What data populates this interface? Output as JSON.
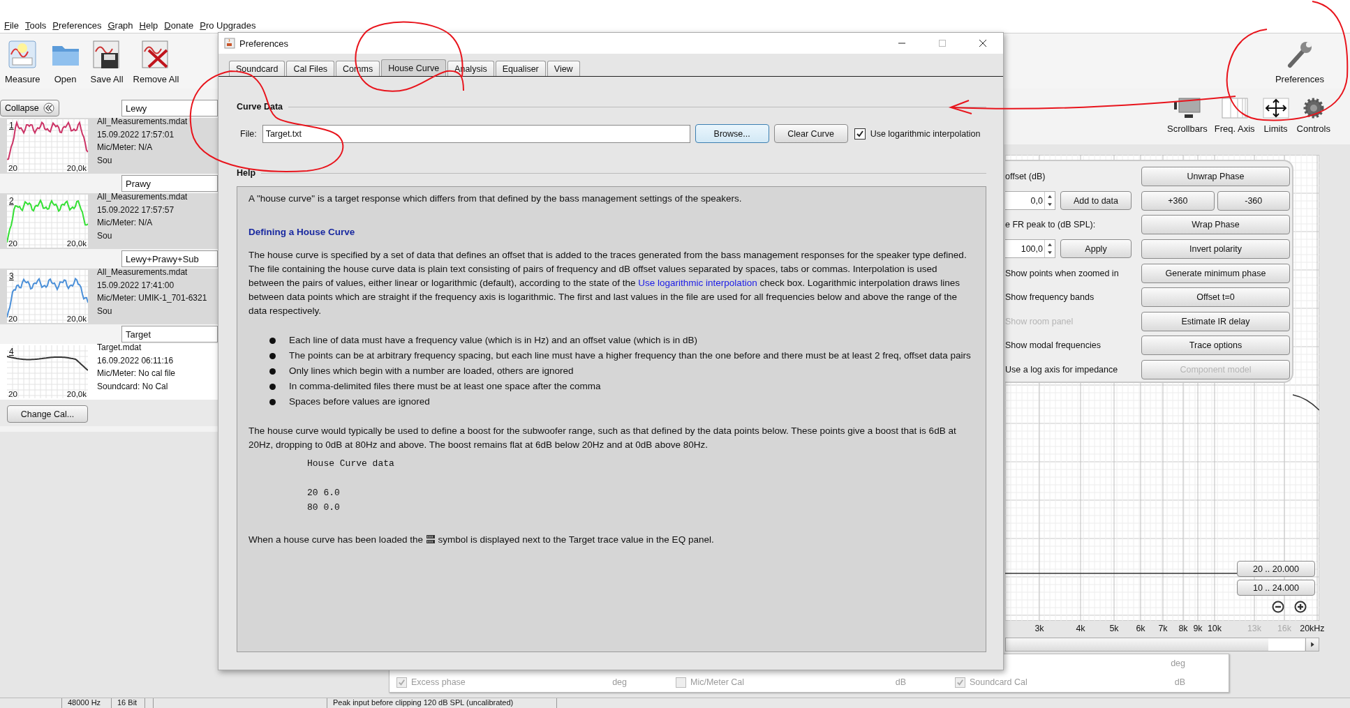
{
  "menu": [
    "File",
    "Tools",
    "Preferences",
    "Graph",
    "Help",
    "Donate",
    "Pro Upgrades"
  ],
  "toolbar": [
    {
      "label": "Measure",
      "kind": "measure"
    },
    {
      "label": "Open",
      "kind": "open"
    },
    {
      "label": "Save All",
      "kind": "save"
    },
    {
      "label": "Remove All",
      "kind": "remove"
    }
  ],
  "preferences_button": "Preferences",
  "collapse_button": "Collapse",
  "measurements": [
    {
      "name": "Lewy",
      "number": "1",
      "color": "#cc3366",
      "x_start": "20",
      "x_end": "20,0k",
      "file": "All_Measurements.mdat",
      "date": "15.09.2022 17:57:01",
      "mic": "Mic/Meter: N/A",
      "soundcard": "Sou",
      "selected": false
    },
    {
      "name": "Prawy",
      "number": "2",
      "color": "#33e033",
      "x_start": "20",
      "x_end": "20,0k",
      "file": "All_Measurements.mdat",
      "date": "15.09.2022 17:57:57",
      "mic": "Mic/Meter: N/A",
      "soundcard": "Sou",
      "selected": false
    },
    {
      "name": "Lewy+Prawy+Sub",
      "number": "3",
      "color": "#4a8fd8",
      "x_start": "20",
      "x_end": "20,0k",
      "file": "All_Measurements.mdat",
      "date": "15.09.2022 17:41:00",
      "mic": "Mic/Meter: UMIK-1_701-6321",
      "soundcard": "Sou",
      "selected": false
    },
    {
      "name": "Target",
      "number": "4",
      "color": "#333333",
      "x_start": "20",
      "x_end": "20,0k",
      "file": "Target.mdat",
      "date": "16.09.2022 06:11:16",
      "mic": "Mic/Meter: No cal file",
      "soundcard": "Soundcard: No Cal",
      "selected": true
    }
  ],
  "change_cal_button": "Change Cal...",
  "graph_toolbar": [
    {
      "label": "Scrollbars",
      "kind": "scrollbars"
    },
    {
      "label": "Freq. Axis",
      "kind": "freq"
    },
    {
      "label": "Limits",
      "kind": "limits"
    },
    {
      "label": "Controls",
      "kind": "controls"
    }
  ],
  "controls_panel": {
    "left_items": [
      {
        "kind": "label",
        "text": "offset (dB)"
      },
      {
        "kind": "spinner",
        "value": "0,0",
        "button": "Add to data"
      },
      {
        "kind": "label",
        "text": "e FR peak to (dB SPL):"
      },
      {
        "kind": "spinner",
        "value": "100,0",
        "button": "Apply"
      },
      {
        "kind": "option",
        "text": "Show points when zoomed in",
        "disabled": false
      },
      {
        "kind": "option",
        "text": "Show frequency bands",
        "disabled": false
      },
      {
        "kind": "option",
        "text": "Show room panel",
        "disabled": true
      },
      {
        "kind": "option",
        "text": "Show modal frequencies",
        "disabled": false
      },
      {
        "kind": "option",
        "text": "Use a log axis for impedance",
        "disabled": false
      }
    ],
    "button_rows": [
      [
        {
          "label": "Unwrap Phase",
          "disabled": false
        }
      ],
      [
        {
          "label": "+360",
          "disabled": false
        },
        {
          "label": "-360",
          "disabled": false
        }
      ],
      [
        {
          "label": "Wrap Phase",
          "disabled": false
        }
      ],
      [
        {
          "label": "Invert polarity",
          "disabled": false
        }
      ],
      [
        {
          "label": "Generate minimum phase",
          "disabled": false
        }
      ],
      [
        {
          "label": "Offset t=0",
          "disabled": false
        }
      ],
      [
        {
          "label": "Estimate IR delay",
          "disabled": false
        }
      ],
      [
        {
          "label": "Trace options",
          "disabled": false
        }
      ],
      [
        {
          "label": "Component model",
          "disabled": true
        }
      ]
    ]
  },
  "graph": {
    "range_buttons": [
      "20 .. 20.000",
      "10 .. 24.000"
    ],
    "freq_labels": [
      {
        "label": "3k",
        "minor": false
      },
      {
        "label": "4k",
        "minor": false
      },
      {
        "label": "5k",
        "minor": false
      },
      {
        "label": "6k",
        "minor": false
      },
      {
        "label": "7k",
        "minor": false
      },
      {
        "label": "8k",
        "minor": false
      },
      {
        "label": "9k",
        "minor": false
      },
      {
        "label": "10k",
        "minor": false
      },
      {
        "label": "13k",
        "minor": true
      },
      {
        "label": "16k",
        "minor": true
      },
      {
        "label": "20kHz",
        "minor": false
      }
    ]
  },
  "bottom_panel": {
    "top_unit": "deg",
    "rows": [
      {
        "label": "Excess phase",
        "unit": "deg",
        "checked": true
      },
      {
        "label": "Mic/Meter Cal",
        "unit": "dB",
        "checked": false
      },
      {
        "label": "Soundcard Cal",
        "unit": "dB",
        "checked": true
      }
    ]
  },
  "status_bar": {
    "sample_rate": "48000 Hz",
    "bit_depth": "16 Bit",
    "message": "Peak input before clipping 120 dB SPL (uncalibrated)"
  },
  "dialog": {
    "title": "Preferences",
    "tabs": [
      {
        "label": "Soundcard",
        "selected": false
      },
      {
        "label": "Cal Files",
        "selected": false
      },
      {
        "label": "Comms",
        "selected": false
      },
      {
        "label": "House Curve",
        "selected": true
      },
      {
        "label": "Analysis",
        "selected": false
      },
      {
        "label": "Equaliser",
        "selected": false
      },
      {
        "label": "View",
        "selected": false
      }
    ],
    "curve_data_heading": "Curve Data",
    "file_label": "File:",
    "file_value": "Target.txt",
    "browse_button": "Browse...",
    "clear_button": "Clear Curve",
    "log_interpolation": {
      "label": "Use logarithmic interpolation",
      "checked": true
    },
    "help_heading": "Help",
    "help": {
      "intro": "A \"house curve\" is a target response which differs from that defined by the bass management settings of the speakers.",
      "section_heading": "Defining a House Curve",
      "paragraph": {
        "before": "The house curve is specified by a set of data that defines an offset that is added to the traces generated from the bass management responses for the speaker type defined. The file containing the house curve data is plain text consisting of pairs of frequency and dB offset values separated by spaces, tabs or commas. Interpolation is used between the pairs of values, either linear or logarithmic (default), according to the state of the ",
        "link": "Use logarithmic interpolation",
        "after": " check box. Logarithmic interpolation draws lines between data points which are straight if the frequency axis is logarithmic. The first and last values in the file are used for all frequencies below and above the range of the data respectively."
      },
      "bullets": [
        "Each line of data must have a frequency value (which is in Hz) and an offset value (which is in dB)",
        "The points can be at arbitrary frequency spacing, but each line must have a higher frequency than the one before and there must be at least 2 freq, offset data pairs",
        "Only lines which begin with a number are loaded, others are ignored",
        "In comma-delimited files there must be at least one space after the comma",
        "Spaces before values are ignored"
      ],
      "example_paragraph": "The house curve would typically be used to define a boost for the subwoofer range, such as that defined by the data points below. These points give a boost that is 6dB at 20Hz, dropping to 0dB at 80Hz and above. The boost remains flat at 6dB below 20Hz and at 0dB above 80Hz.",
      "code_title": "House Curve data",
      "code_rows": [
        "20 6.0",
        "80 0.0"
      ],
      "closing": {
        "before": "When a house curve has been loaded the ",
        "after": " symbol is displayed next to the Target trace value in the EQ panel."
      }
    }
  }
}
